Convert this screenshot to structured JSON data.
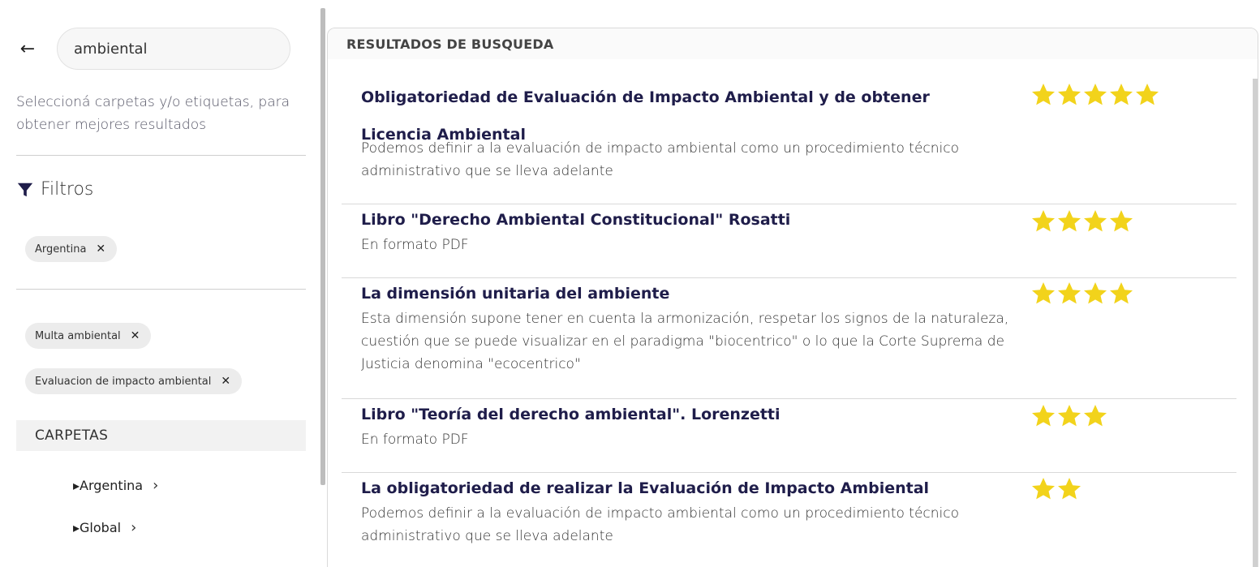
{
  "sidebar": {
    "back_icon": "left-arrow-icon",
    "search": {
      "value": "ambiental",
      "placeholder": ""
    },
    "hint": "Seleccioná carpetas y/o etiquetas, para obtener mejores resultados",
    "filters_label": "Filtros",
    "country_chips": [
      {
        "label": "Argentina",
        "remove": "✕"
      }
    ],
    "tag_chips": [
      {
        "label": "Multa ambiental",
        "remove": "✕"
      },
      {
        "label": "Evaluacion de impacto ambiental",
        "remove": "✕"
      }
    ],
    "folders_label": "CARPETAS",
    "folders": [
      {
        "label": "▸Argentina",
        "chevron": "›"
      },
      {
        "label": "▸Global",
        "chevron": "›"
      }
    ]
  },
  "results": {
    "header": "RESULTADOS DE BUSQUEDA",
    "star_color": "#f2d31b",
    "items": [
      {
        "title": "Obligatoriedad de Evaluación de Impacto Ambiental y de obtener Licencia Ambiental",
        "description": "Podemos definir a la evaluación de impacto ambiental como un procedimiento técnico administrativo que se lleva adelante",
        "rating": 5
      },
      {
        "title": "Libro \"Derecho Ambiental Constitucional\" Rosatti",
        "description": "En formato PDF",
        "rating": 4
      },
      {
        "title": "La dimensión unitaria del ambiente",
        "description": "Esta dimensión supone tener en cuenta la armonización, respetar los signos de la naturaleza, cuestión que se puede visualizar en el paradigma \"biocentrico\" o lo que la Corte Suprema de Justicia denomina \"ecocentrico\"",
        "rating": 4
      },
      {
        "title": "Libro \"Teoría del derecho ambiental\". Lorenzetti",
        "description": "En formato PDF",
        "rating": 3
      },
      {
        "title": "La obligatoriedad de realizar la Evaluación de Impacto Ambiental",
        "description": "Podemos definir a la evaluación de impacto ambiental como un procedimiento técnico administrativo que se lleva adelante",
        "rating": 2
      }
    ]
  }
}
